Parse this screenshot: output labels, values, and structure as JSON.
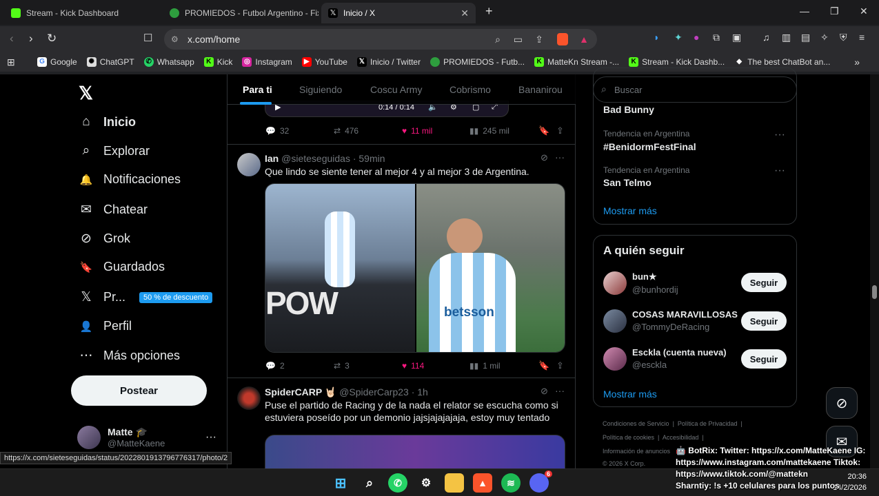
{
  "browser": {
    "tabs": [
      {
        "title": "Stream - Kick Dashboard",
        "color": "#53fc18"
      },
      {
        "title": "PROMIEDOS - Futbol Argentino - Fixt",
        "color": "#2e9e3e"
      },
      {
        "title": "Inicio / X",
        "color": "#ffffff"
      }
    ],
    "url": "x.com/home",
    "bookmarks": [
      "Google",
      "ChatGPT",
      "Whatsapp",
      "Kick",
      "Instagram",
      "YouTube",
      "Inicio / Twitter",
      "PROMIEDOS - Futb...",
      "MatteKn Stream -...",
      "Stream - Kick Dashb...",
      "The best ChatBot an..."
    ]
  },
  "sidebar": {
    "logo": "𝕏",
    "items": [
      {
        "label": "Inicio",
        "icon": "home-icon",
        "glyph": "⌂"
      },
      {
        "label": "Explorar",
        "icon": "search-icon",
        "glyph": "⌕"
      },
      {
        "label": "Notificaciones",
        "icon": "bell-icon",
        "glyph": "🔔"
      },
      {
        "label": "Chatear",
        "icon": "mail-icon",
        "glyph": "✉"
      },
      {
        "label": "Grok",
        "icon": "grok-icon",
        "glyph": "⊘"
      },
      {
        "label": "Guardados",
        "icon": "bookmark-icon",
        "glyph": "🔖"
      },
      {
        "label": "Pr...",
        "icon": "x-premium-icon",
        "glyph": "𝕏"
      },
      {
        "label": "Perfil",
        "icon": "user-icon",
        "glyph": "👤"
      },
      {
        "label": "Más opciones",
        "icon": "more-circle-icon",
        "glyph": "⋯"
      }
    ],
    "promo": "50 % de descuento",
    "post_button": "Postear",
    "user": {
      "name": "Matte 🎓",
      "handle": "@MatteKaene",
      "more": "···"
    }
  },
  "feed": {
    "tabs": [
      "Para ti",
      "Siguiendo",
      "Coscu Army",
      "Cobrismo",
      "Bananirou"
    ],
    "media_time": "0:14 / 0:14",
    "first_post_actions": {
      "replies": "32",
      "reposts": "476",
      "likes": "11 mil",
      "views": "245 mil"
    },
    "posts": [
      {
        "name": "Ian",
        "handle": "@sieteseguidas",
        "time": "· 59min",
        "text": "Que lindo se siente tener al mejor 4 y al mejor 3 de Argentina.",
        "replies": "2",
        "reposts": "3",
        "likes": "114",
        "views": "1 mil"
      },
      {
        "name": "SpiderCARP 🤘🏻",
        "handle": "@SpiderCarp23",
        "time": "· 1h",
        "text": "Puse el partido de Racing y de la nada el relator se escucha como si estuviera poseído por un demonio jajsjajajajaja, estoy muy tentado"
      }
    ],
    "image_text": {
      "left": "POW",
      "right": "betsson"
    }
  },
  "right": {
    "search_placeholder": "Buscar",
    "trends": [
      {
        "label": "",
        "value": "Bad Bunny"
      },
      {
        "label": "Tendencia en Argentina",
        "value": "#BenidormFestFinal"
      },
      {
        "label": "Tendencia en Argentina",
        "value": "San Telmo"
      }
    ],
    "show_more": "Mostrar más",
    "who_to_follow_title": "A quién seguir",
    "suggestions": [
      {
        "name": "bun★",
        "handle": "@bunhordij"
      },
      {
        "name": "COSAS MARAVILLOSAS",
        "handle": "@TommyDeRacing"
      },
      {
        "name": "Esckla (cuenta nueva)",
        "handle": "@esckla"
      }
    ],
    "follow_label": "Seguir",
    "footer": [
      "Condiciones de Servicio",
      "Política de Privacidad",
      "Política de cookies",
      "Accesibilidad",
      "Información de anuncios",
      "© 2026 X Corp."
    ]
  },
  "status_url": "https://x.com/sieteseguidas/status/2022801913796776317/photo/2",
  "chat_overlay": {
    "line1": "🤖 BotRix: Twitter: https://x.com/MatteKaene IG: https://www.instagram.com/mattekaene Tiktok: https://www.tiktok.com/@mattekn",
    "line2": "Sharntiy: !s +10 celulares para los puntos"
  },
  "clock": {
    "time": "20:36",
    "date": "14/2/2026"
  },
  "taskbar_badge": "6"
}
